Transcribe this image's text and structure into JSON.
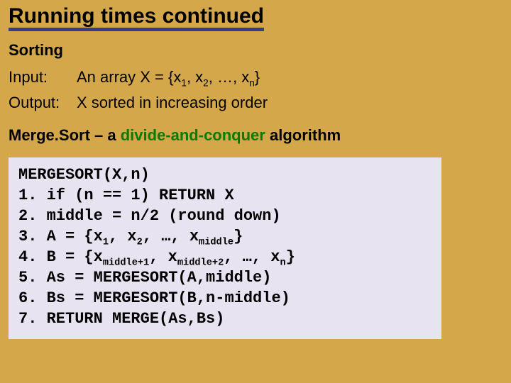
{
  "title": "Running times continued",
  "section": "Sorting",
  "input_label": "Input:",
  "output_label": "Output:",
  "input_text_pre": "An array X = {x",
  "input_text_mid1": ", x",
  "input_text_mid2": ", …, x",
  "input_text_post": "}",
  "input_sub1": "1",
  "input_sub2": "2",
  "input_subn": "n",
  "output_text": "X sorted in increasing order",
  "merge_pre": "Merge.Sort ",
  "merge_dash": "– a ",
  "merge_green": "divide-and-conquer",
  "merge_post": " algorithm",
  "code": {
    "l0": "MERGESORT(X,n)",
    "l1": "1. if (n == 1) RETURN X",
    "l2": "2. middle = n/2 (round down)",
    "l3_pre": "3. A = {x",
    "l3_s1": "1",
    "l3_m1": ", x",
    "l3_s2": "2",
    "l3_m2": ", …, x",
    "l3_s3": "middle",
    "l3_post": "}",
    "l4_pre": "4. B = {x",
    "l4_s1": "middle+1",
    "l4_m1": ", x",
    "l4_s2": "middle+2",
    "l4_m2": ", …, x",
    "l4_s3": "n",
    "l4_post": "}",
    "l5": "5. As = MERGESORT(A,middle)",
    "l6": "6. Bs = MERGESORT(B,n-middle)",
    "l7": "7. RETURN MERGE(As,Bs)"
  }
}
